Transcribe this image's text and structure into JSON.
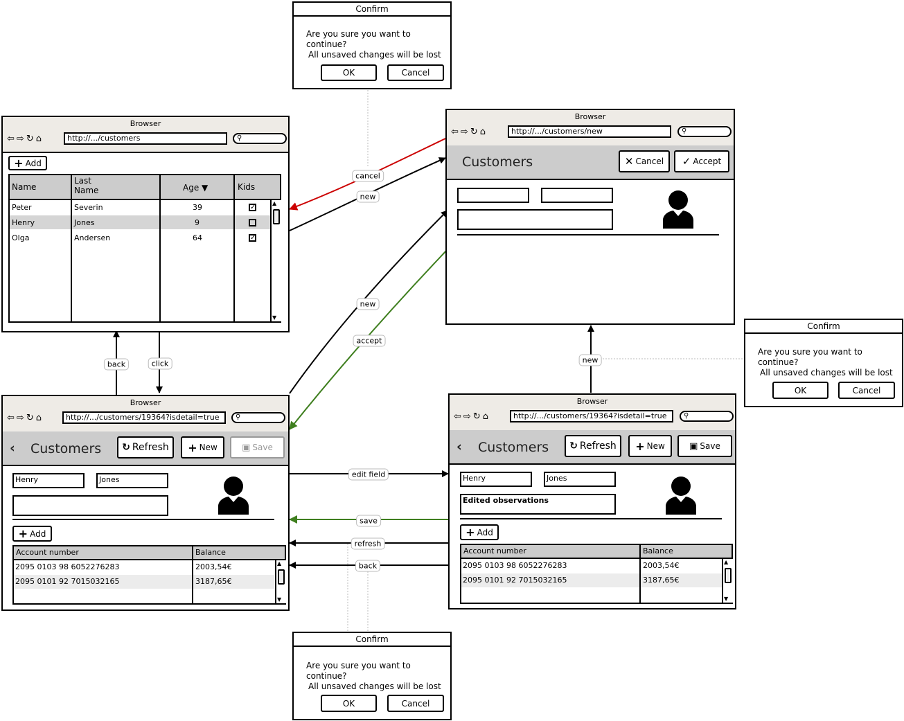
{
  "colors": {
    "cancel_edge": "#cc0000",
    "accept_edge": "#3f7f1f",
    "default_edge": "#000000",
    "toolbar_bg": "#cccccc",
    "chrome_bg": "#eeebe6"
  },
  "confirm_dialog": {
    "title": "Confirm",
    "line1": "Are you sure you want to continue?",
    "line2": "All unsaved changes will be lost",
    "ok": "OK",
    "cancel": "Cancel"
  },
  "list_screen": {
    "browser_title": "Browser",
    "url": "http://.../customers",
    "add_label": "Add",
    "columns": [
      "Name",
      "Last Name",
      "Age",
      "Kids"
    ],
    "sort_indicator": "▼",
    "rows": [
      {
        "name": "Peter",
        "last": "Severin",
        "age": "39",
        "kids": true
      },
      {
        "name": "Henry",
        "last": "Jones",
        "age": "9",
        "kids": false
      },
      {
        "name": "Olga",
        "last": "Andersen",
        "age": "64",
        "kids": true
      }
    ],
    "selected_row": 1
  },
  "new_screen": {
    "browser_title": "Browser",
    "url": "http://.../customers/new",
    "title": "Customers",
    "cancel_label": "Cancel",
    "accept_label": "Accept"
  },
  "detail_screen": {
    "browser_title": "Browser",
    "url": "http://.../customers/19364?isdetail=true",
    "title": "Customers",
    "refresh_label": "Refresh",
    "new_label": "New",
    "save_label": "Save",
    "first_name": "Henry",
    "last_name": "Jones",
    "observations": "",
    "add_label": "Add",
    "columns": [
      "Account number",
      "Balance"
    ],
    "rows": [
      {
        "account": "2095 0103 98 6052276283",
        "balance": "2003,54€"
      },
      {
        "account": "2095 0101 92 7015032165",
        "balance": "3187,65€"
      }
    ]
  },
  "edited_screen": {
    "browser_title": "Browser",
    "url": "http://.../customers/19364?isdetail=true",
    "title": "Customers",
    "refresh_label": "Refresh",
    "new_label": "New",
    "save_label": "Save",
    "first_name": "Henry",
    "last_name": "Jones",
    "observations": "Edited observations",
    "add_label": "Add",
    "columns": [
      "Account number",
      "Balance"
    ],
    "rows": [
      {
        "account": "2095 0103 98 6052276283",
        "balance": "2003,54€"
      },
      {
        "account": "2095 0101 92 7015032165",
        "balance": "3187,65€"
      }
    ]
  },
  "edges": {
    "cancel": "cancel",
    "new_top": "new",
    "new_mid": "new",
    "accept": "accept",
    "back_left": "back",
    "click": "click",
    "new_right": "new",
    "edit_field": "edit field",
    "save": "save",
    "refresh": "refresh",
    "back_bottom": "back"
  }
}
